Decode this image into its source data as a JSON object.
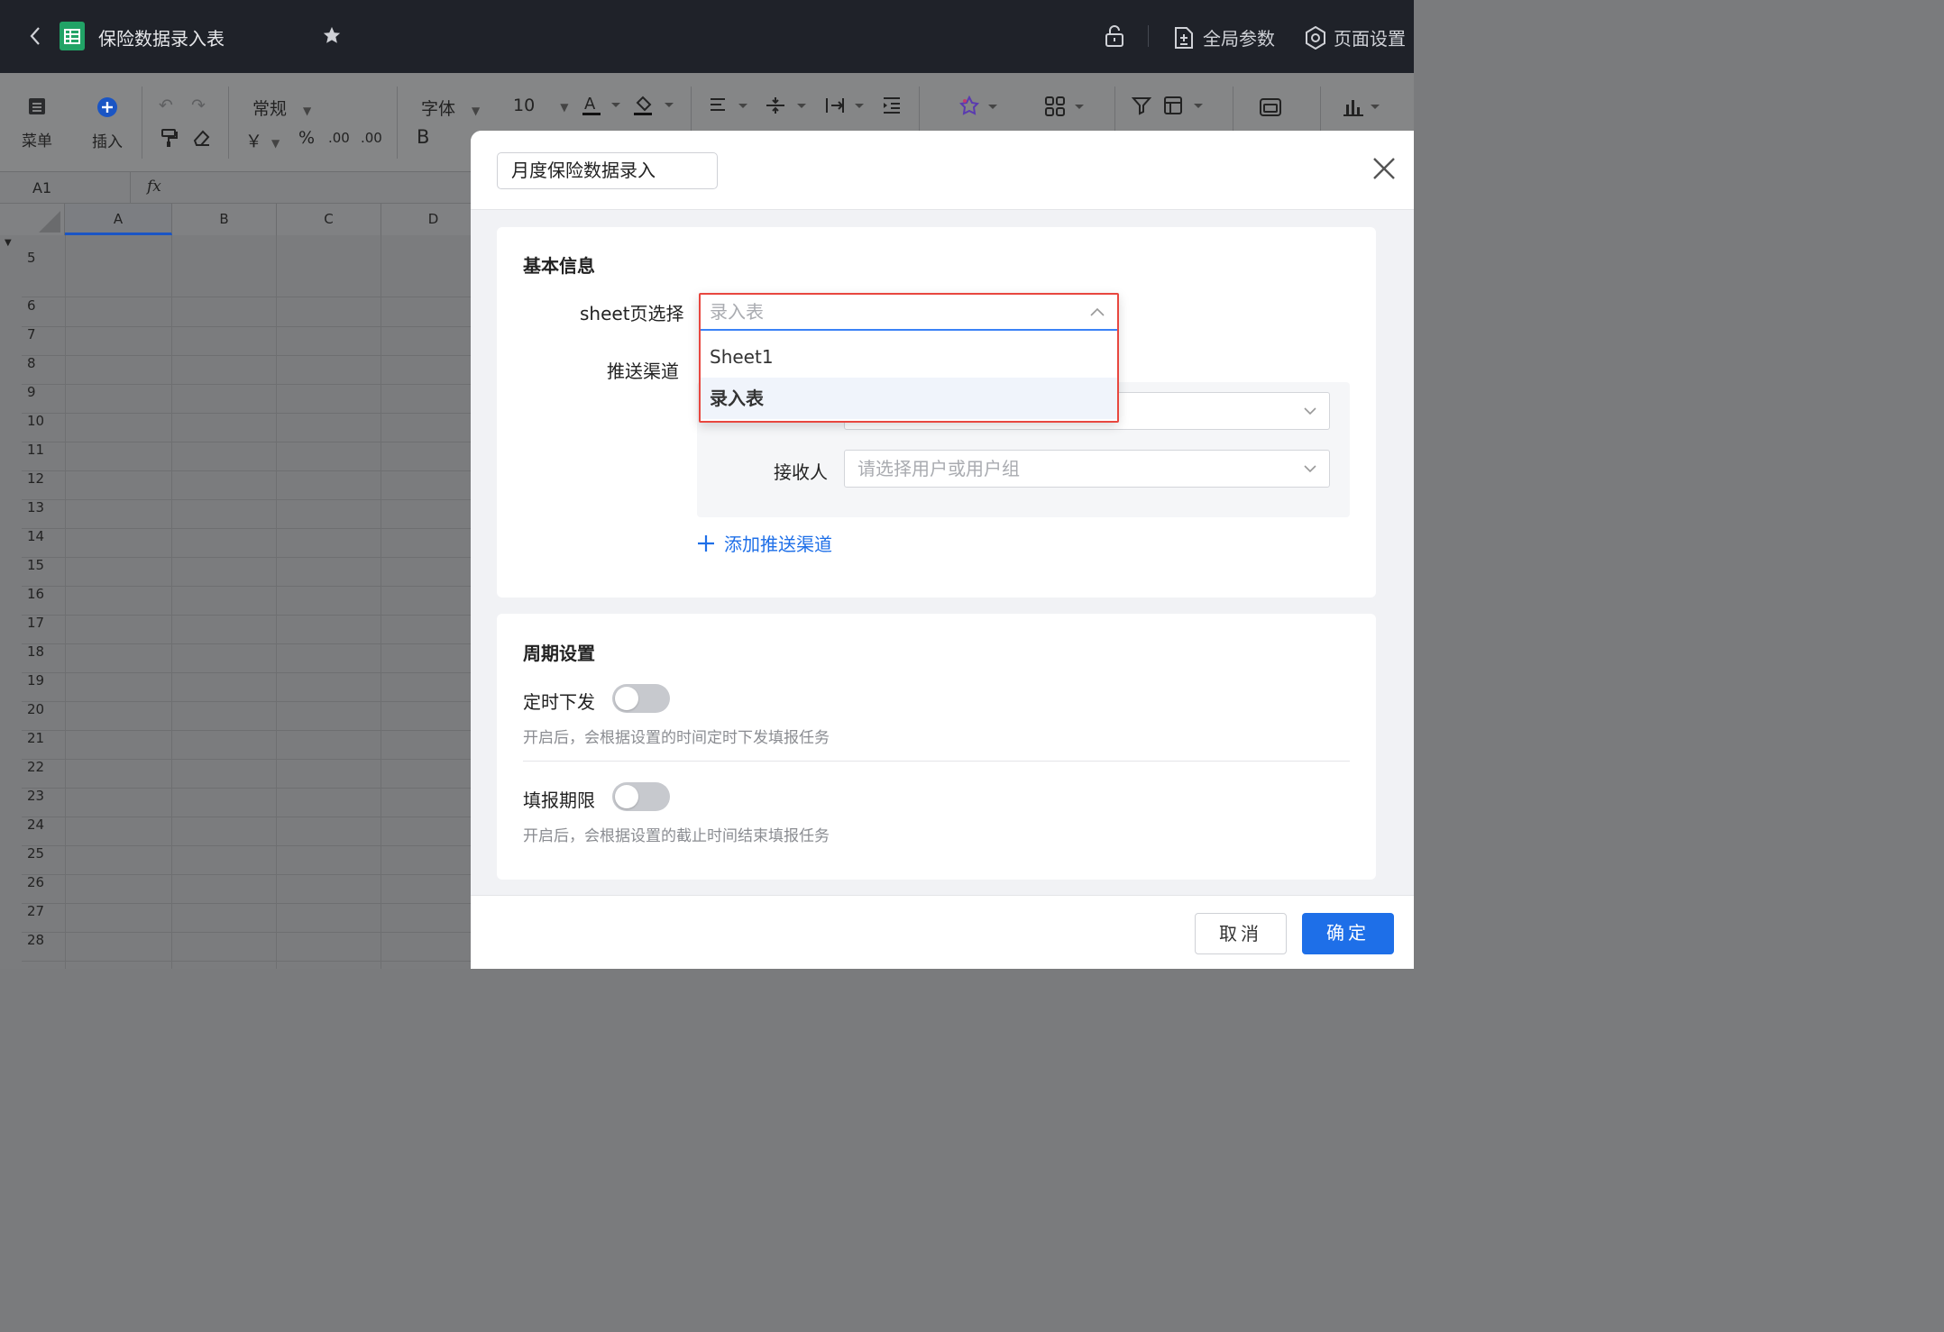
{
  "topbar": {
    "title": "保险数据录入表",
    "global_params": "全局参数",
    "page_settings": "页面设置"
  },
  "toolbar": {
    "menu": "菜单",
    "insert": "插入",
    "format_general": "常规",
    "font": "字体",
    "font_size": "10",
    "bold": "B",
    "currency": "￥",
    "percent": "%",
    "dec_dec": ".00",
    "dec_inc": ".00"
  },
  "formula_bar": {
    "cell_ref": "A1",
    "fx": "fx"
  },
  "grid": {
    "columns": [
      "A",
      "B",
      "C",
      "D"
    ],
    "rows": [
      "5",
      "6",
      "7",
      "8",
      "9",
      "10",
      "11",
      "12",
      "13",
      "14",
      "15",
      "16",
      "17",
      "18",
      "19",
      "20",
      "21",
      "22",
      "23",
      "24",
      "25",
      "26",
      "27",
      "28"
    ]
  },
  "modal": {
    "title_value": "月度保险数据录入",
    "basic_section": "基本信息",
    "sheet_label": "sheet页选择",
    "sheet_value": "录入表",
    "channel_label": "推送渠道",
    "recipient_label": "接收人",
    "recipient_placeholder": "请选择用户或用户组",
    "add_channel": "添加推送渠道",
    "cycle_section": "周期设置",
    "schedule_label": "定时下发",
    "schedule_desc": "开启后，会根据设置的时间定时下发填报任务",
    "deadline_label": "填报期限",
    "deadline_desc": "开启后，会根据设置的截止时间结束填报任务",
    "cancel": "取消",
    "confirm": "确定"
  },
  "dropdown": {
    "placeholder": "录入表",
    "options": [
      "Sheet1",
      "录入表"
    ],
    "selected": "录入表"
  },
  "colors": {
    "accent": "#1e6fe8",
    "highlight_border": "#e8473f",
    "topbar_bg": "#1f2229"
  }
}
